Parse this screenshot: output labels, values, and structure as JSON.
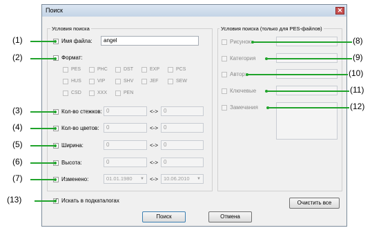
{
  "window": {
    "title": "Поиск",
    "close_glyph": "✕"
  },
  "left_group": {
    "title": "Условия поиска",
    "filename": {
      "label": "Имя файла:",
      "value": "angel"
    },
    "format": {
      "label": "Формат:",
      "options": [
        "PES",
        "PHC",
        "DST",
        "EXP",
        "PCS",
        "HUS",
        "VIP",
        "SHV",
        "JEF",
        "SEW",
        "CSD",
        "XXX",
        "PEN"
      ]
    },
    "stitch_count": {
      "label": "Кол-во стежков:",
      "from": "0",
      "to": "0"
    },
    "color_count": {
      "label": "Кол-во цветов:",
      "from": "0",
      "to": "0"
    },
    "width": {
      "label": "Ширина:",
      "from": "0",
      "to": "0"
    },
    "height": {
      "label": "Высота:",
      "from": "0",
      "to": "0"
    },
    "modified": {
      "label": "Изменено:",
      "from": "01.01.1980",
      "to": "10.06.2010"
    },
    "range_separator": "<->",
    "subfolders_label": "Искать в подкаталогах"
  },
  "right_group": {
    "title": "Условия поиска (только для PES-файлов)",
    "picture_label": "Рисунок:",
    "category_label": "Категория",
    "author_label": "Автор:",
    "keywords_label": "Ключевые",
    "notes_label": "Замечания"
  },
  "buttons": {
    "clear": "Очистить все",
    "search": "Поиск",
    "cancel": "Отмена"
  },
  "callouts": [
    "(1)",
    "(2)",
    "(3)",
    "(4)",
    "(5)",
    "(6)",
    "(7)",
    "(8)",
    "(9)",
    "(10)",
    "(11)",
    "(12)",
    "(13)"
  ],
  "colors": {
    "callout_line": "#1fa32a",
    "title_bar": "#c4d4e6",
    "dialog_bg": "#f0f0f0"
  }
}
